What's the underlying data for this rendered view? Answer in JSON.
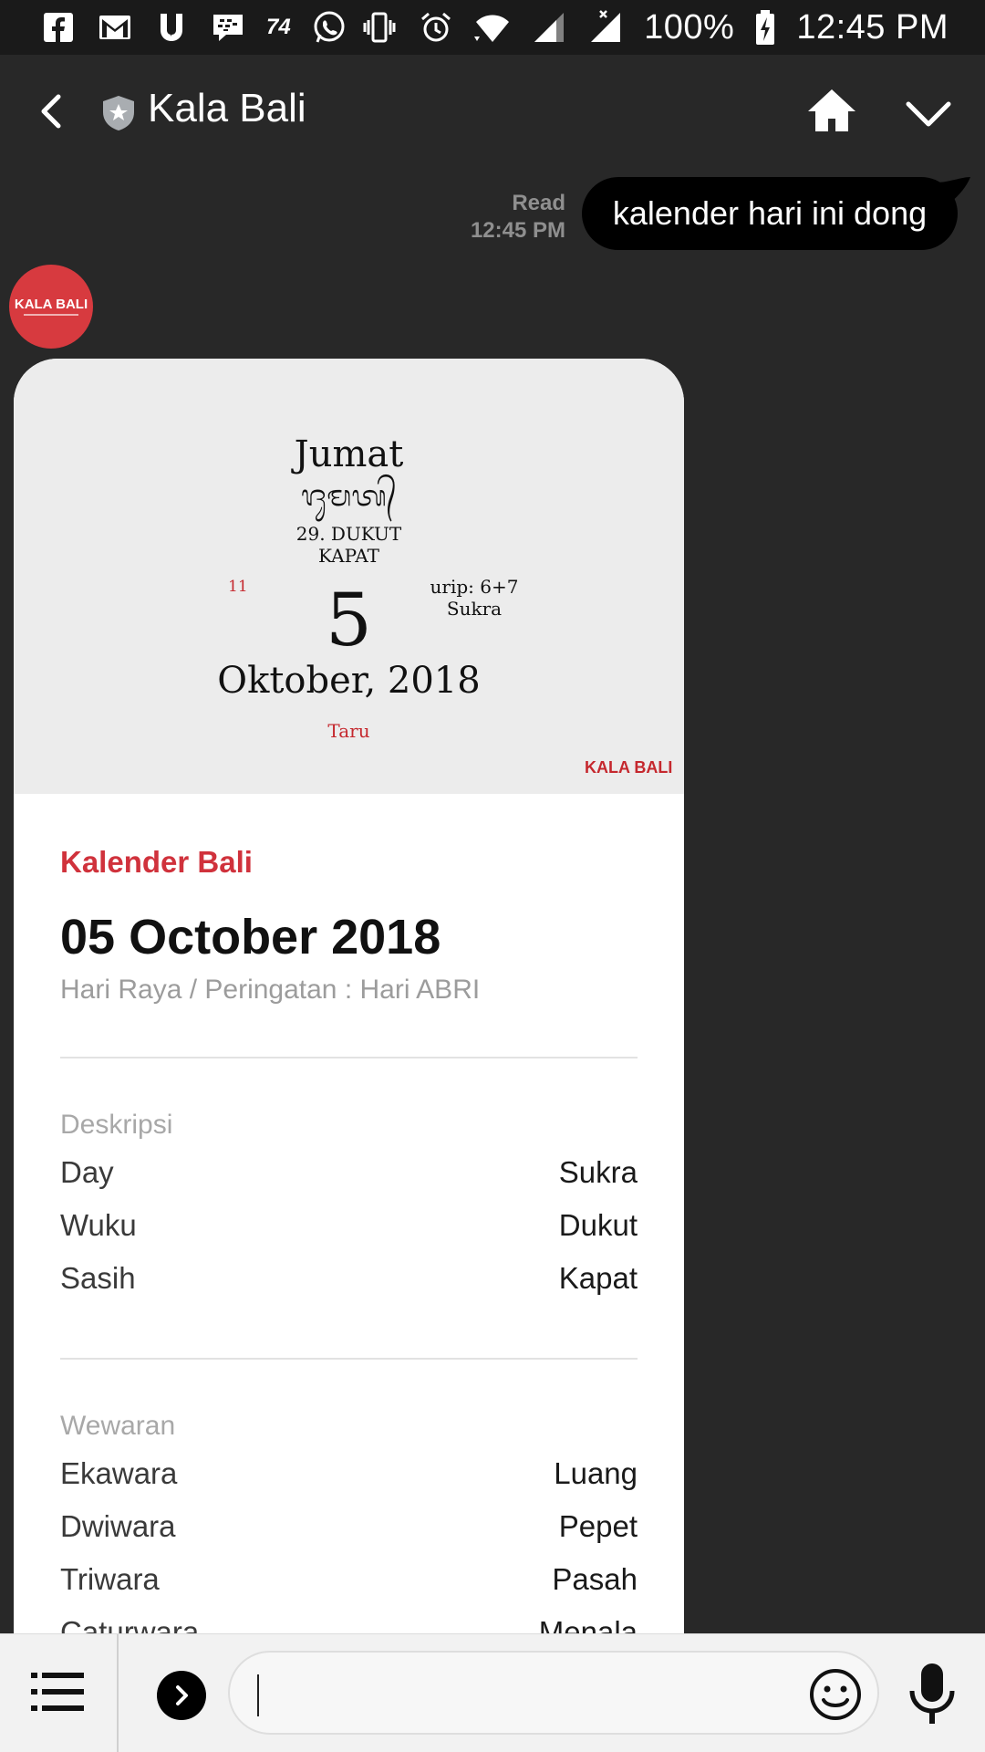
{
  "status_bar": {
    "notification_icons": [
      "facebook-icon",
      "gmail-icon",
      "ubersuggest-icon",
      "bbm-icon",
      "notification-count",
      "whatsapp-icon"
    ],
    "notification_count": "74",
    "system_icons": [
      "vibrate-icon",
      "alarm-icon",
      "wifi-icon",
      "signal-icon",
      "no-signal-icon",
      "battery-charging-icon"
    ],
    "battery": "100%",
    "time": "12:45 PM"
  },
  "header": {
    "title": "Kala Bali",
    "back_icon": "back-arrow-icon",
    "official_icon": "shield-star-icon",
    "home_icon": "home-icon",
    "menu_icon": "chevron-down-icon"
  },
  "outgoing_message": {
    "status": "Read",
    "time": "12:45 PM",
    "text": "kalender hari ini dong"
  },
  "avatar": {
    "label": "KALA BALI"
  },
  "card": {
    "image": {
      "day": "Jumat",
      "script": "ᬚᬸᬫᬢ᭄",
      "wuku_line1": "29. DUKUT",
      "wuku_line2": "KAPAT",
      "red_number": "11",
      "urip_line1": "urip: 6+7",
      "urip_line2": "Sukra",
      "big_date": "5",
      "month_year": "Oktober, 2018",
      "taru": "Taru",
      "logo": "KALA BALI"
    },
    "label": "Kalender Bali",
    "date": "05 October 2018",
    "holiday": "Hari Raya / Peringatan : Hari ABRI",
    "sections": [
      {
        "title": "Deskripsi",
        "rows": [
          {
            "key": "Day",
            "value": "Sukra"
          },
          {
            "key": "Wuku",
            "value": "Dukut"
          },
          {
            "key": "Sasih",
            "value": "Kapat"
          }
        ]
      },
      {
        "title": "Wewaran",
        "rows": [
          {
            "key": "Ekawara",
            "value": "Luang"
          },
          {
            "key": "Dwiwara",
            "value": "Pepet"
          },
          {
            "key": "Triwara",
            "value": "Pasah"
          },
          {
            "key": "Caturwara",
            "value": "Menala"
          }
        ]
      }
    ]
  },
  "input_bar": {
    "menu_icon": "list-menu-icon",
    "expand_icon": "chevron-right-icon",
    "input_value": "",
    "emoji_icon": "emoji-icon",
    "mic_icon": "microphone-icon"
  }
}
